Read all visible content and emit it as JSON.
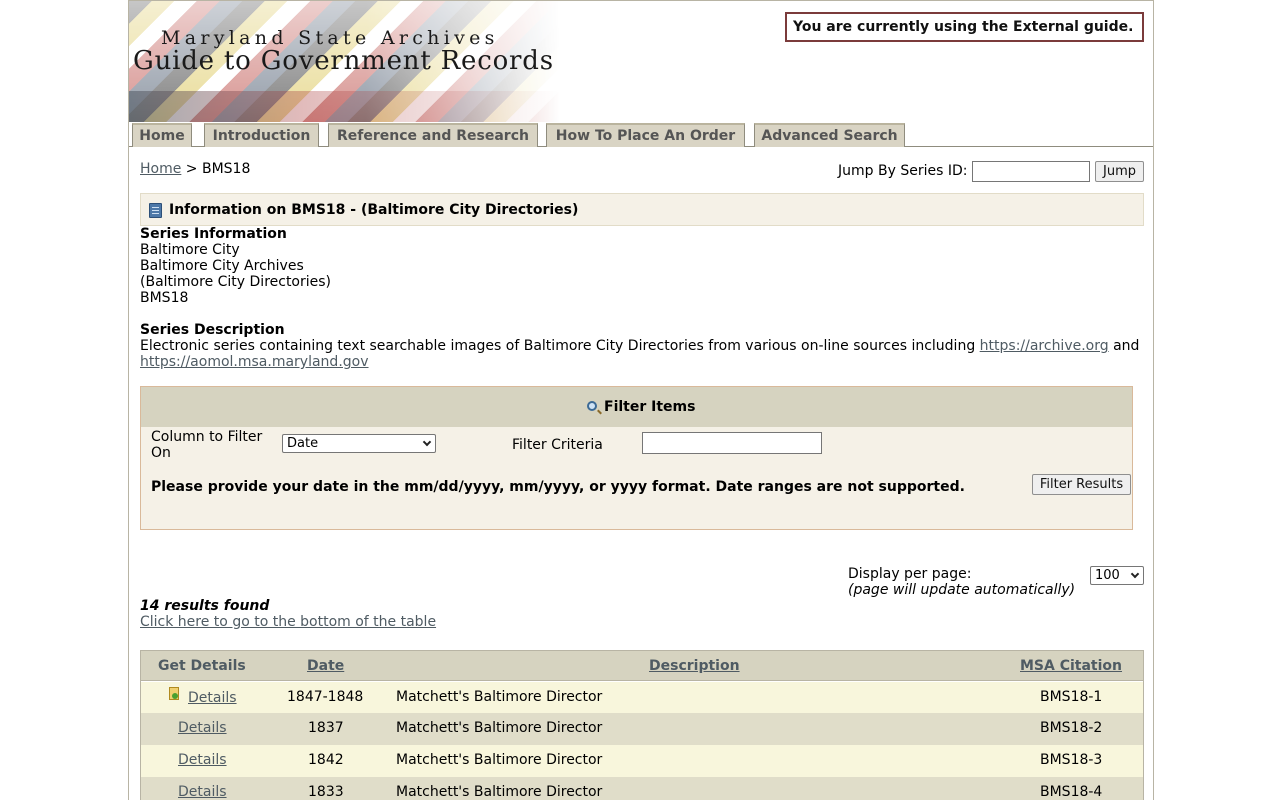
{
  "header": {
    "subtitle": "Maryland State Archives",
    "title": "Guide to Government Records",
    "guide_notice": "You are currently using the External guide."
  },
  "nav": {
    "tabs": [
      {
        "label": "Home"
      },
      {
        "label": "Introduction"
      },
      {
        "label": "Reference and Research"
      },
      {
        "label": "How To Place An Order"
      },
      {
        "label": "Advanced Search"
      }
    ]
  },
  "breadcrumb": {
    "home": "Home",
    "separator": ">",
    "current": "BMS18"
  },
  "jump": {
    "label": "Jump By Series ID:",
    "value": "",
    "button": "Jump"
  },
  "info": {
    "title": "Information on BMS18 - (Baltimore City Directories)"
  },
  "series_info": {
    "heading": "Series Information",
    "lines": [
      "Baltimore City",
      "Baltimore City Archives",
      "(Baltimore City Directories)",
      "BMS18"
    ]
  },
  "series_desc": {
    "heading": "Series Description",
    "text": "Electronic series containing text searchable images of Baltimore City Directories from various on-line sources including",
    "link1": "https://archive.org",
    "and": "and",
    "link2": "https://aomol.msa.maryland.gov"
  },
  "filter": {
    "title": "Filter Items",
    "column_label": "Column to Filter On",
    "column_value": "Date",
    "criteria_label": "Filter Criteria",
    "criteria_value": "",
    "hint": "Please provide your date in the mm/dd/yyyy, mm/yyyy, or yyyy format. Date ranges are not supported.",
    "button": "Filter Results"
  },
  "pagination": {
    "label": "Display per page:",
    "note": "(page will update automatically)",
    "value": "100"
  },
  "results": {
    "count": "14 results found",
    "to_bottom": "Click here to go to the bottom of the table"
  },
  "table": {
    "headers": [
      "Get Details",
      "Date",
      "Description",
      "MSA Citation"
    ],
    "rows": [
      {
        "details": "Details",
        "date": "1847-1848",
        "description": "Matchett's Baltimore Director",
        "citation": "BMS18-1"
      },
      {
        "details": "Details",
        "date": "1837",
        "description": "Matchett's Baltimore Director",
        "citation": "BMS18-2"
      },
      {
        "details": "Details",
        "date": "1842",
        "description": "Matchett's Baltimore Director",
        "citation": "BMS18-3"
      },
      {
        "details": "Details",
        "date": "1833",
        "description": "Matchett's Baltimore Director",
        "citation": "BMS18-4"
      }
    ]
  },
  "colors": {
    "tab_bg": "#d9d4c4",
    "header_band": "#d6d3c0",
    "row_odd": "#f8f6dc",
    "row_even": "#e0ddc9",
    "link": "#4f5b63",
    "notice_border": "#7b3b3b"
  },
  "icons": {
    "info": "book-icon",
    "filter": "magnifier-icon",
    "row_marker": "document-icon"
  }
}
